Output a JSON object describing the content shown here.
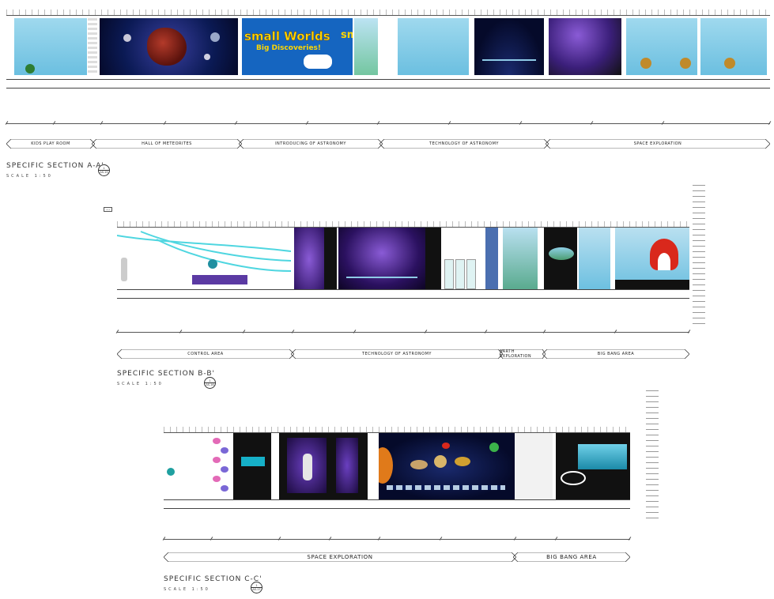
{
  "sections": [
    {
      "id": "a",
      "title": "SPECIFIC SECTION A-A'",
      "scale": "SCALE 1:50",
      "ref": {
        "top": "1",
        "bottom": "AS-15"
      },
      "zones": [
        "KIDS PLAY ROOM",
        "HALL OF METEORITES",
        "INTRODUCING OF ASTRONOMY",
        "TECHNOLOGY OF ASTRONOMY",
        "SPACE EXPLORATION"
      ],
      "feature_text": {
        "line1": "small Worlds",
        "line1b": "sm",
        "line2": "Big Discoveries!"
      }
    },
    {
      "id": "b",
      "title": "SPECIFIC SECTION B-B'",
      "scale": "SCALE 1:50",
      "ref": {
        "top": "1",
        "bottom": "AS-16"
      },
      "zones": [
        "CONTROL AREA",
        "TECHNOLOGY OF ASTRONOMY",
        "EARTH EXPLORATION",
        "BIG BANG AREA"
      ]
    },
    {
      "id": "c",
      "title": "SPECIFIC SECTION C-C'",
      "scale": "SCALE 1:50",
      "ref": {
        "top": "1",
        "bottom": "AS-17"
      },
      "zones": [
        "SPACE EXPLORATION",
        "BIG BANG AREA"
      ]
    }
  ],
  "colors": {
    "sky": "#7ec8e3",
    "space": "#0b1a55",
    "nebula": "#3b1f7a",
    "banner": "#1565c0",
    "banner_text": "#ffd600",
    "red": "#d9281c",
    "dark": "#111111"
  }
}
